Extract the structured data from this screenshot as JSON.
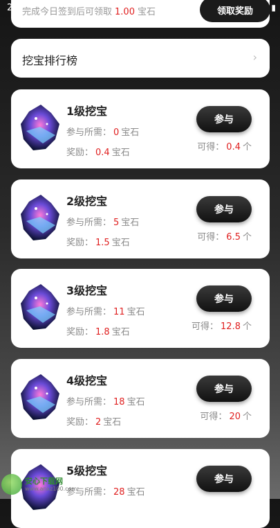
{
  "status_bar": {
    "time": "2",
    "icons": [
      "wifi-icon",
      "battery-icon"
    ]
  },
  "checkin_note": {
    "prefix": "完成今日签到后可领取",
    "amount": "1.00",
    "unit": "宝石"
  },
  "claim_button": "领取奖励",
  "ranking": {
    "label": "挖宝排行榜"
  },
  "levels": [
    {
      "title": "1级挖宝",
      "required_label": "参与所需：",
      "required": "0",
      "required_unit": "宝石",
      "reward_label": "奖励：",
      "reward": "0.4",
      "reward_unit": "宝石",
      "join": "参与",
      "get_label": "可得：",
      "get": "0.4",
      "get_unit": "个"
    },
    {
      "title": "2级挖宝",
      "required_label": "参与所需：",
      "required": "5",
      "required_unit": "宝石",
      "reward_label": "奖励：",
      "reward": "1.5",
      "reward_unit": "宝石",
      "join": "参与",
      "get_label": "可得：",
      "get": "6.5",
      "get_unit": "个"
    },
    {
      "title": "3级挖宝",
      "required_label": "参与所需：",
      "required": "11",
      "required_unit": "宝石",
      "reward_label": "奖励：",
      "reward": "1.8",
      "reward_unit": "宝石",
      "join": "参与",
      "get_label": "可得：",
      "get": "12.8",
      "get_unit": "个"
    },
    {
      "title": "4级挖宝",
      "required_label": "参与所需：",
      "required": "18",
      "required_unit": "宝石",
      "reward_label": "奖励：",
      "reward": "2",
      "reward_unit": "宝石",
      "join": "参与",
      "get_label": "可得：",
      "get": "20",
      "get_unit": "个"
    },
    {
      "title": "5级挖宝",
      "required_label": "参与所需：",
      "required": "28",
      "required_unit": "宝石",
      "join": "参与"
    }
  ],
  "watermark": {
    "name": "安心下载网",
    "site": "www.anxz100.com"
  },
  "colors": {
    "accent_red": "#e02020",
    "button_dark": "#1b1b1b",
    "card_bg": "#ffffff"
  }
}
